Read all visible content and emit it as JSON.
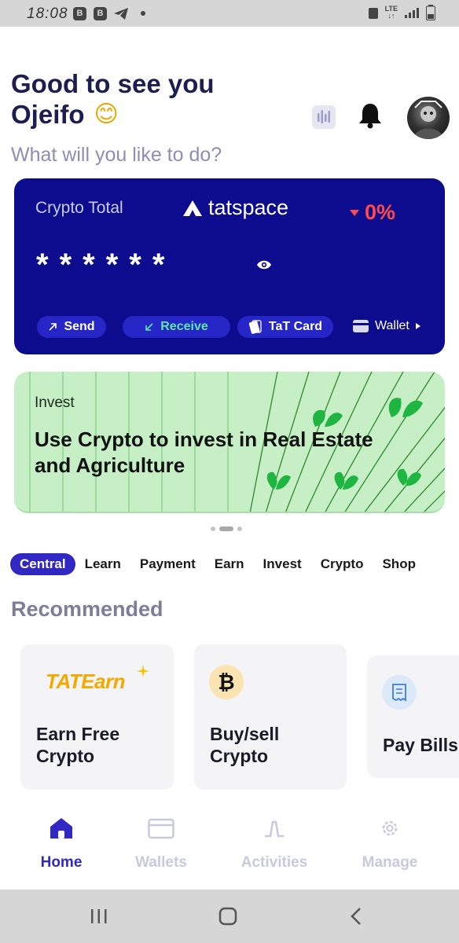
{
  "status_bar": {
    "time": "18:08",
    "network": "LTE"
  },
  "header": {
    "greeting_line1": "Good to see you",
    "greeting_line2": "Ojeifo",
    "greeting_emoji": "😊",
    "subtitle": "What will you like to do?",
    "icons": [
      "chart-bars-icon",
      "bell-icon"
    ]
  },
  "crypto_card": {
    "title": "Crypto Total",
    "brand": "tatspace",
    "change": "0%",
    "masked_balance": "******",
    "actions": {
      "send": "Send",
      "receive": "Receive",
      "tat_card": "TaT Card",
      "wallet": "Wallet"
    },
    "colors": {
      "background": "#0d0c8f",
      "change": "#ff4a4a",
      "receive": "#5ee6a8"
    }
  },
  "banner": {
    "kicker": "Invest",
    "title": "Use Crypto to invest in Real Estate and Agriculture",
    "background": "#c6efc6"
  },
  "tabs": [
    {
      "label": "Central",
      "active": true
    },
    {
      "label": "Learn"
    },
    {
      "label": "Payment"
    },
    {
      "label": "Earn"
    },
    {
      "label": "Invest"
    },
    {
      "label": "Crypto"
    },
    {
      "label": "Shop"
    }
  ],
  "recommended": {
    "title": "Recommended",
    "items": [
      {
        "logo": "TATEarn",
        "label": "Earn Free Crypto"
      },
      {
        "icon": "bitcoin-icon",
        "label": "Buy/sell Crypto"
      },
      {
        "icon": "receipt-icon",
        "label": "Pay Bills"
      }
    ]
  },
  "bottom_nav": {
    "items": [
      {
        "label": "Home",
        "icon": "home-icon",
        "active": true
      },
      {
        "label": "Wallets",
        "icon": "wallet-icon"
      },
      {
        "label": "Activities",
        "icon": "activities-icon"
      },
      {
        "label": "Manage",
        "icon": "gear-icon"
      }
    ],
    "active_color": "#3128c4",
    "inactive_color": "#c8c9de"
  }
}
